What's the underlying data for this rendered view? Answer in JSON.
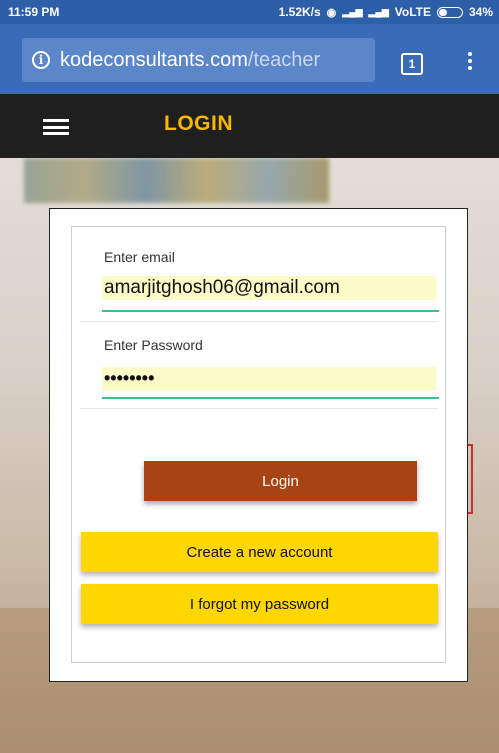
{
  "status_bar": {
    "time": "11:59 PM",
    "network_speed": "1.52K/s",
    "wifi_icon": "◉",
    "signal_1": "▂▄▆",
    "signal_2": "▂▄▆",
    "volte": "VoLTE",
    "battery": "34%"
  },
  "browser": {
    "url_domain": "kodeconsultants.com",
    "url_path": "/teacher",
    "tab_count": "1"
  },
  "app_bar": {
    "title": "LOGIN"
  },
  "form": {
    "email_label": "Enter email",
    "email_value": "amarjitghosh06@gmail.com",
    "password_label": "Enter Password",
    "password_value": "••••••••",
    "login_button": "Login",
    "create_account_button": "Create a new account",
    "forgot_password_button": "I forgot my password"
  },
  "colors": {
    "status_bar": "#2d5ea8",
    "browser_bar": "#3a6bb8",
    "app_bar": "#1f1f1f",
    "title_accent": "#f5b700",
    "login_button": "#a84413",
    "secondary_button": "#fed600",
    "input_underline": "#35c489",
    "input_fill": "#fbfbc8"
  }
}
